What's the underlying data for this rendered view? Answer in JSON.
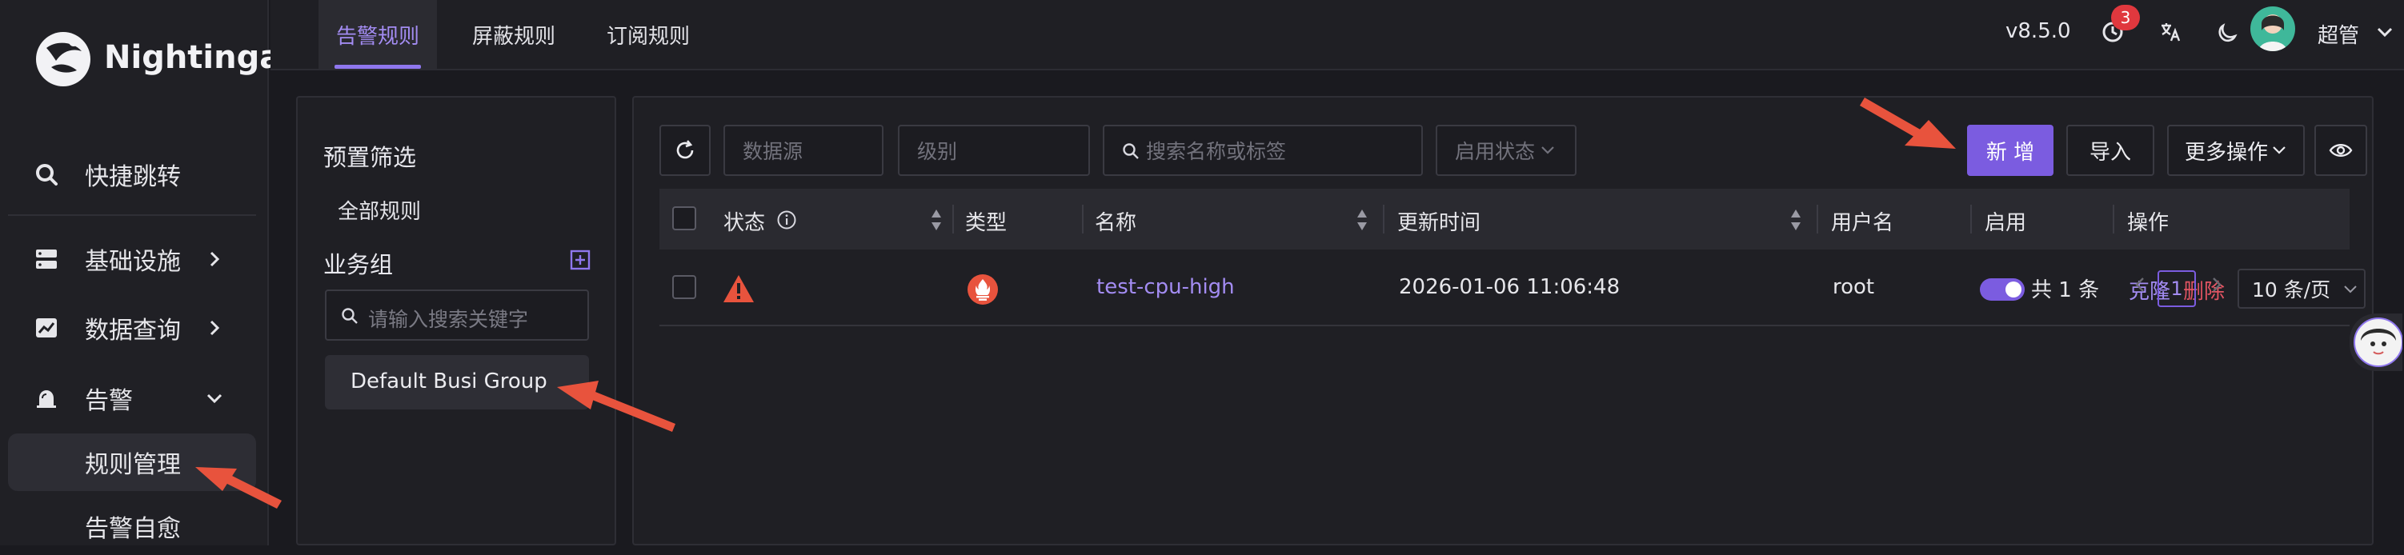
{
  "app": {
    "name": "Nightingale",
    "version": "v8.5.0",
    "notification_count": "3",
    "user_name": "超管"
  },
  "sidebar": {
    "items": [
      {
        "label": "快捷跳转",
        "icon": "search-icon"
      },
      {
        "label": "基础设施",
        "icon": "server-icon"
      },
      {
        "label": "数据查询",
        "icon": "chart-icon"
      },
      {
        "label": "告警",
        "icon": "alarm-bell-icon"
      }
    ],
    "subitems": [
      {
        "label": "规则管理",
        "active": true
      },
      {
        "label": "告警自愈",
        "active": false
      }
    ]
  },
  "tabs": [
    {
      "label": "告警规则",
      "active": true
    },
    {
      "label": "屏蔽规则",
      "active": false
    },
    {
      "label": "订阅规则",
      "active": false
    }
  ],
  "filter_panel": {
    "preset_title": "预置筛选",
    "all_rules": "全部规则",
    "business_group_title": "业务组",
    "search_placeholder": "请输入搜索关键字",
    "groups": [
      {
        "name": "Default Busi Group"
      }
    ]
  },
  "toolbar": {
    "datasource_placeholder": "数据源",
    "severity_placeholder": "级别",
    "search_placeholder": "搜索名称或标签",
    "status_placeholder": "启用状态",
    "new_label": "新 增",
    "import_label": "导入",
    "more_label": "更多操作"
  },
  "table": {
    "columns": [
      "状态",
      "类型",
      "名称",
      "更新时间",
      "用户名",
      "启用",
      "操作"
    ],
    "rows": [
      {
        "status": "warning",
        "type": "prometheus",
        "name": "test-cpu-high",
        "updated": "2026-01-06 11:06:48",
        "user": "root",
        "enabled": true,
        "op_clone": "克隆",
        "op_delete": "删除"
      }
    ]
  },
  "pagination": {
    "total": "共 1 条",
    "current": "1",
    "page_size": "10 条/页"
  },
  "colors": {
    "accent": "#7b5ce0",
    "danger": "#e45563",
    "warning": "#e8533d",
    "background": "#1a1a1f"
  }
}
